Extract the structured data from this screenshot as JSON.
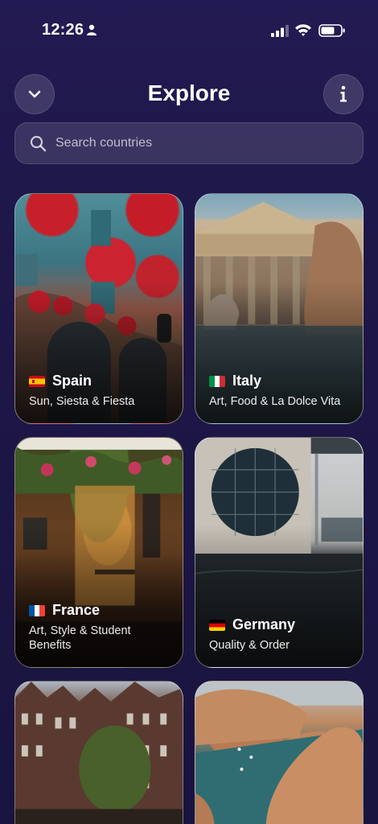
{
  "status_bar": {
    "time": "12:26"
  },
  "header": {
    "title": "Explore"
  },
  "search": {
    "placeholder": "Search countries"
  },
  "countries": [
    {
      "name": "Spain",
      "tagline": "Sun, Siesta & Fiesta",
      "flag_icon": "spain-flag-icon"
    },
    {
      "name": "Italy",
      "tagline": "Art, Food & La Dolce Vita",
      "flag_icon": "italy-flag-icon"
    },
    {
      "name": "France",
      "tagline": "Art, Style & Student Benefits",
      "flag_icon": "france-flag-icon"
    },
    {
      "name": "Germany",
      "tagline": "Quality & Order",
      "flag_icon": "germany-flag-icon"
    }
  ],
  "colors": {
    "background": "#1a1440",
    "text": "#ffffff"
  }
}
